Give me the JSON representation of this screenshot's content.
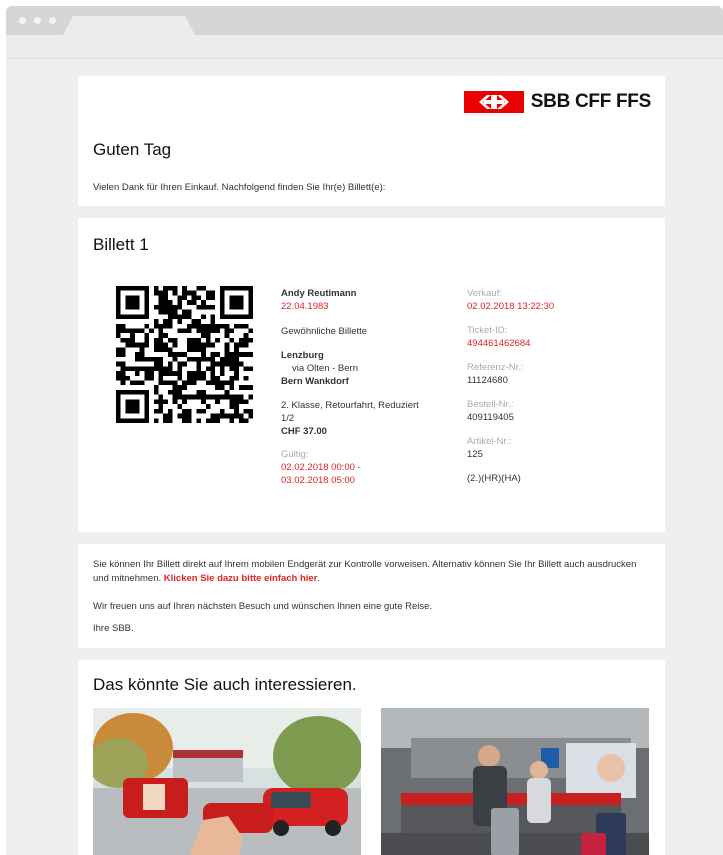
{
  "header": {
    "logo_text": "SBB CFF FFS",
    "greeting": "Guten Tag",
    "intro": "Vielen Dank für Ihren Einkauf. Nachfolgend finden Sie Ihr(e) Billett(e):"
  },
  "ticket": {
    "title": "Billett 1",
    "passenger_name": "Andy Reutimann",
    "birth_date": "22.04.1983",
    "ticket_type": "Gewöhnliche Billette",
    "from": "Lenzburg",
    "via": "via Olten - Bern",
    "to": "Bern Wankdorf",
    "class_line1": "2. Klasse, Retourfahrt, Reduziert",
    "class_line2": "1/2",
    "price": "CHF 37.00",
    "valid_label": "Gültig:",
    "valid_from": "02.02.2018 00:00 -",
    "valid_to": "03.02.2018 05:00",
    "sale_label": "Verkauf:",
    "sale_value": "02.02.2018 13:22:30",
    "ticket_id_label": "Ticket-ID:",
    "ticket_id_value": "494461462684",
    "reference_label": "Referenz-Nr.:",
    "reference_value": "11124680",
    "order_label": "Bestell-Nr.:",
    "order_value": "409119405",
    "article_label": "Artikel-Nr.:",
    "article_value": "125",
    "code": "(2.)(HR)(HA)"
  },
  "info": {
    "text_part1": "Sie können Ihr Billett direkt auf Ihrem mobilen Endgerät zur Kontrolle vorweisen. Alternativ können Sie Ihr Billett auch ausdrucken und mitnehmen.",
    "link_text": "Klicken Sie dazu bitte einfach hier",
    "text_part2": "Wir freuen uns auf Ihren nächsten Besuch und wünschen Ihnen eine gute Reise.",
    "signature": "Ihre SBB."
  },
  "promo": {
    "title": "Das könnte Sie auch interessieren."
  },
  "colors": {
    "accent": "#e02424",
    "brand": "#eb0000"
  }
}
